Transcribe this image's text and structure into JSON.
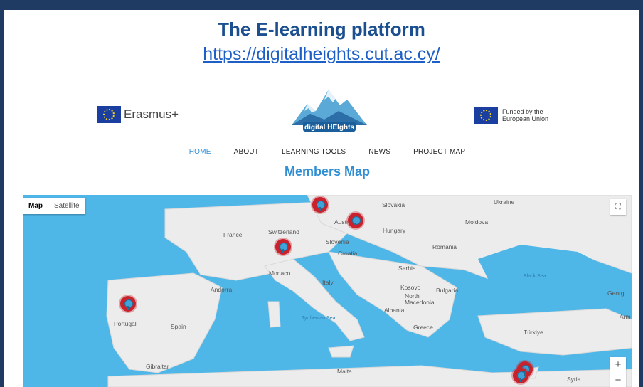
{
  "slide": {
    "title": "The E-learning platform",
    "url": "https://digitalheights.cut.ac.cy/"
  },
  "site": {
    "erasmus_label": "Erasmus+",
    "logo_text": "digital HEIghts",
    "funded_text": "Funded by the European Union",
    "nav": [
      "HOME",
      "ABOUT",
      "LEARNING TOOLS",
      "NEWS",
      "PROJECT MAP"
    ],
    "nav_active": "HOME",
    "section_title": "Members Map"
  },
  "map": {
    "toggle": {
      "map": "Map",
      "satellite": "Satellite"
    },
    "zoom_in": "+",
    "zoom_out": "−",
    "labels": {
      "slovakia": "Slovakia",
      "ukraine": "Ukraine",
      "france": "France",
      "switzerland": "Switzerland",
      "austria": "Austria",
      "hungary": "Hungary",
      "moldova": "Moldova",
      "slovenia": "Slovenia",
      "croatia": "Croatia",
      "romania": "Romania",
      "monaco": "Monaco",
      "serbia": "Serbia",
      "andorra": "Andorra",
      "italy": "Italy",
      "kosovo": "Kosovo",
      "bulgaria": "Bulgaria",
      "north_macedonia": "North\nMacedonia",
      "albania": "Albania",
      "georgia": "Georgi",
      "portugal": "Portugal",
      "spain": "Spain",
      "greece": "Greece",
      "turkiye": "Türkiye",
      "armenia": "Arm",
      "gibraltar": "Gibraltar",
      "malta": "Malta",
      "syria": "Syria",
      "black_sea": "Black Sea",
      "tyrrhenian_sea": "Tyrrhenian Sea"
    },
    "accent_pin_color": "#c8232c",
    "sea_color": "#4fb6e8",
    "land_color": "#ececec"
  }
}
